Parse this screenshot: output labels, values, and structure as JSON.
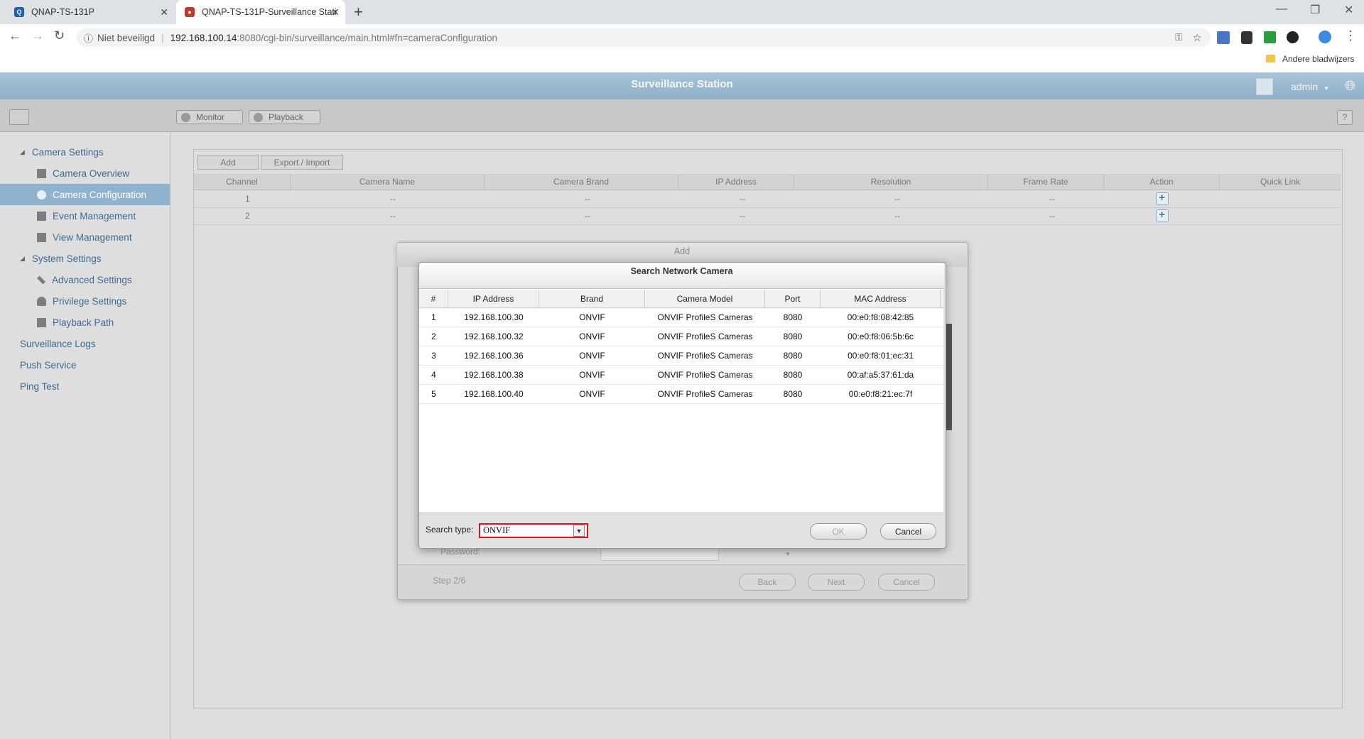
{
  "browser": {
    "tabs": [
      {
        "title": "QNAP-TS-131P"
      },
      {
        "title": "QNAP-TS-131P-Surveillance Stati"
      }
    ],
    "security_label": "Niet beveiligd",
    "url_host": "192.168.100.14",
    "url_rest": ":8080/cgi-bin/surveillance/main.html#fn=cameraConfiguration",
    "bookmarks_folder": "Andere bladwijzers"
  },
  "app": {
    "title": "Surveillance Station",
    "user": "admin",
    "toolbar": {
      "monitor": "Monitor",
      "playback": "Playback",
      "help": "?"
    }
  },
  "sidebar": {
    "camera_settings": "Camera Settings",
    "camera_overview": "Camera Overview",
    "camera_configuration": "Camera Configuration",
    "event_management": "Event Management",
    "view_management": "View Management",
    "system_settings": "System Settings",
    "advanced_settings": "Advanced Settings",
    "privilege_settings": "Privilege Settings",
    "playback_path": "Playback Path",
    "surveillance_logs": "Surveillance Logs",
    "push_service": "Push Service",
    "ping_test": "Ping Test"
  },
  "content": {
    "add_label": "Add",
    "export_import_label": "Export / Import",
    "columns": [
      "Channel",
      "Camera Name",
      "Camera Brand",
      "IP Address",
      "Resolution",
      "Frame Rate",
      "Action",
      "Quick Link"
    ],
    "rows": [
      {
        "channel": "1",
        "name": "--",
        "brand": "--",
        "ip": "--",
        "resolution": "--",
        "fps": "--"
      },
      {
        "channel": "2",
        "name": "--",
        "brand": "--",
        "ip": "--",
        "resolution": "--",
        "fps": "--"
      }
    ]
  },
  "add_dialog": {
    "title": "Add",
    "password_label": "Password:",
    "step": "Step 2/6",
    "back": "Back",
    "next": "Next",
    "cancel": "Cancel"
  },
  "search_dialog": {
    "title": "Search Network Camera",
    "columns": [
      "#",
      "IP Address",
      "Brand",
      "Camera Model",
      "Port",
      "MAC Address"
    ],
    "rows": [
      {
        "n": "1",
        "ip": "192.168.100.30",
        "brand": "ONVIF",
        "model": "ONVIF ProfileS Cameras",
        "port": "8080",
        "mac": "00:e0:f8:08:42:85"
      },
      {
        "n": "2",
        "ip": "192.168.100.32",
        "brand": "ONVIF",
        "model": "ONVIF ProfileS Cameras",
        "port": "8080",
        "mac": "00:e0:f8:06:5b:6c"
      },
      {
        "n": "3",
        "ip": "192.168.100.36",
        "brand": "ONVIF",
        "model": "ONVIF ProfileS Cameras",
        "port": "8080",
        "mac": "00:e0:f8:01:ec:31"
      },
      {
        "n": "4",
        "ip": "192.168.100.38",
        "brand": "ONVIF",
        "model": "ONVIF ProfileS Cameras",
        "port": "8080",
        "mac": "00:af:a5:37:61:da"
      },
      {
        "n": "5",
        "ip": "192.168.100.40",
        "brand": "ONVIF",
        "model": "ONVIF ProfileS Cameras",
        "port": "8080",
        "mac": "00:e0:f8:21:ec:7f"
      }
    ],
    "search_type_label": "Search type:",
    "search_type_value": "ONVIF",
    "ok": "OK",
    "cancel": "Cancel"
  },
  "colors": {
    "accent": "#8fb3cf",
    "header": "#9dbbd0",
    "highlight": "#e0141e"
  }
}
